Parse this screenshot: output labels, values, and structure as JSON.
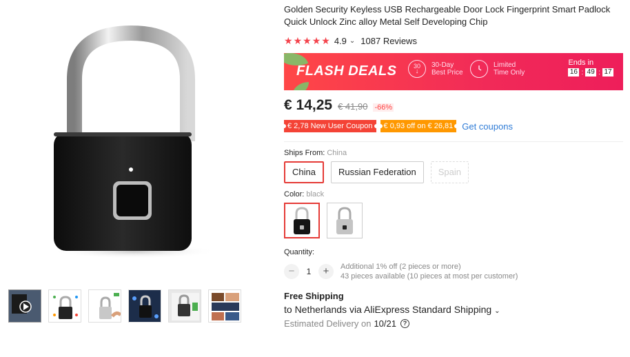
{
  "product": {
    "title": "Golden Security Keyless USB Rechargeable Door Lock Fingerprint Smart Padlock Quick Unlock Zinc alloy Metal Self Developing Chip",
    "rating": "4.9",
    "reviews": "1087 Reviews",
    "stars": 5
  },
  "flash": {
    "title": "FLASH DEALS",
    "feature1_icon": "30",
    "feature1_line1": "30-Day",
    "feature1_line2": "Best Price",
    "feature2_line1": "Limited",
    "feature2_line2": "Time Only",
    "ends_label": "Ends in",
    "hours": "16",
    "minutes": "49",
    "seconds": "17",
    "sep": ":"
  },
  "price": {
    "current": "€ 14,25",
    "original": "€ 41,90",
    "discount": "-66%"
  },
  "coupons": {
    "new_user": "€ 2,78 New User Coupon",
    "off": "€ 0,93 off on € 26,81",
    "get": "Get coupons"
  },
  "ships_from": {
    "label": "Ships From:",
    "value": "China",
    "options": [
      "China",
      "Russian Federation",
      "Spain"
    ]
  },
  "color": {
    "label": "Color:",
    "value": "black"
  },
  "quantity": {
    "label": "Quantity:",
    "value": "1",
    "minus": "−",
    "plus": "+",
    "info1": "Additional 1% off (2 pieces or more)",
    "info2": "43 pieces available (10 pieces at most per customer)"
  },
  "shipping": {
    "title": "Free Shipping",
    "to": "to Netherlands via AliExpress Standard Shipping",
    "delivery_label": "Estimated Delivery on",
    "delivery_date": "10/21",
    "help": "?"
  },
  "colors": {
    "accent": "#e53935",
    "flash_start": "#ff4747",
    "flash_end": "#ee1e5a",
    "star": "#f4424b",
    "link": "#2e7bd6"
  }
}
